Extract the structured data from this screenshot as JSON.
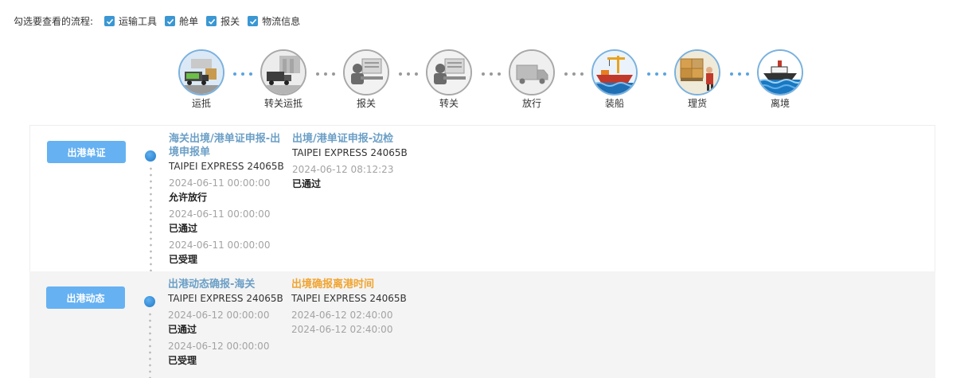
{
  "filter": {
    "label": "勾选要查看的流程:",
    "options": [
      {
        "label": "运输工具",
        "checked": true
      },
      {
        "label": "舱单",
        "checked": true
      },
      {
        "label": "报关",
        "checked": true
      },
      {
        "label": "物流信息",
        "checked": true
      }
    ]
  },
  "process": {
    "steps": [
      {
        "label": "运抵",
        "icon": "cargo-truck-icon",
        "active": true
      },
      {
        "label": "转关运抵",
        "icon": "transfer-truck-icon",
        "active": false
      },
      {
        "label": "报关",
        "icon": "customs-officer-icon",
        "active": false
      },
      {
        "label": "转关",
        "icon": "customs-officer-icon",
        "active": false
      },
      {
        "label": "放行",
        "icon": "truck-icon",
        "active": false
      },
      {
        "label": "装船",
        "icon": "ship-loading-icon",
        "active": true
      },
      {
        "label": "理货",
        "icon": "tally-worker-icon",
        "active": true
      },
      {
        "label": "离境",
        "icon": "ship-departure-icon",
        "active": true
      }
    ],
    "connector_colors": [
      "blue",
      "gray",
      "gray",
      "gray",
      "gray",
      "blue",
      "blue"
    ]
  },
  "sections": {
    "port_docs": {
      "button": "出港单证",
      "col1": {
        "title": "海关出境/港单证申报-出境申报单",
        "vessel": "TAIPEI EXPRESS 24065B",
        "events": [
          {
            "time": "2024-06-11 00:00:00",
            "status": "允许放行"
          },
          {
            "time": "2024-06-11 00:00:00",
            "status": "已通过"
          },
          {
            "time": "2024-06-11 00:00:00",
            "status": "已受理"
          }
        ]
      },
      "col2": {
        "title": "出境/港单证申报-边检",
        "vessel": "TAIPEI EXPRESS 24065B",
        "events": [
          {
            "time": "2024-06-12 08:12:23",
            "status": "已通过"
          }
        ]
      }
    },
    "port_dynamics": {
      "button": "出港动态",
      "col1": {
        "title": "出港动态确报-海关",
        "vessel": "TAIPEI EXPRESS 24065B",
        "events": [
          {
            "time": "2024-06-12 00:00:00",
            "status": "已通过"
          },
          {
            "time": "2024-06-12 00:00:00",
            "status": "已受理"
          }
        ]
      },
      "col2": {
        "title": "出境确报离港时间",
        "vessel": "TAIPEI EXPRESS 24065B",
        "times": [
          "2024-06-12 02:40:00",
          "2024-06-12 02:40:00"
        ]
      }
    }
  },
  "colors": {
    "accent": "#66b1f2",
    "title_blue": "#6b9fc6",
    "title_orange": "#f0a431",
    "checkbox": "#3b97d3"
  }
}
